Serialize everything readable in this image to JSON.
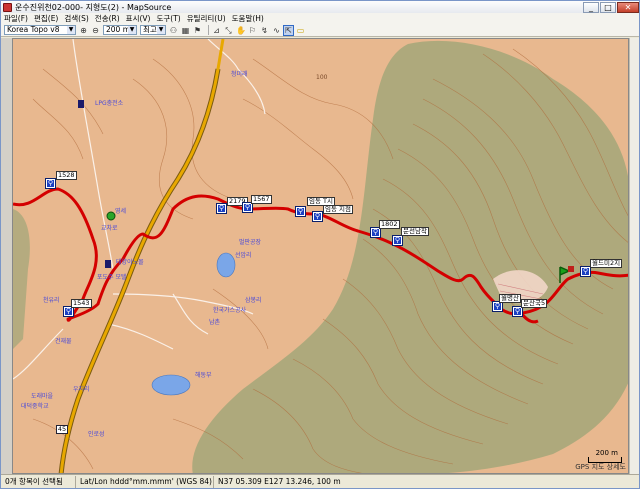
{
  "window": {
    "title": "운수진위천02-000- 지형도(2) - MapSource",
    "minimize": "_",
    "maximize": "□",
    "close": "✕"
  },
  "menu": [
    "파일(F)",
    "편집(E)",
    "검색(S)",
    "전송(R)",
    "표시(V)",
    "도구(T)",
    "유틸리티(U)",
    "도움말(H)"
  ],
  "toolbar": {
    "map_product": "Korea Topo v8",
    "zoom_value": "200 m",
    "detail": "최고"
  },
  "map": {
    "road_number": "45",
    "contour_label": "100",
    "waypoints": [
      {
        "label": "1528"
      },
      {
        "label": "2179"
      },
      {
        "label": "1567"
      },
      {
        "label": "임동 T시"
      },
      {
        "label": "임동 지점"
      },
      {
        "label": "1802"
      },
      {
        "label": "문선남작"
      },
      {
        "label": "1543"
      },
      {
        "label": "월명산"
      },
      {
        "label": "문산국5"
      },
      {
        "label": "월드미2지"
      }
    ],
    "pois": [
      "청미래",
      "LPG충전소",
      "영세",
      "교차로",
      "태양이노몰",
      "벌판공장",
      "선암리",
      "포도주 모텔",
      "천유리",
      "삼봉리",
      "남촌",
      "한국가스공사",
      "건재물",
      "해동부",
      "도래마을",
      "대덕중학교",
      "우지리",
      "인로성"
    ],
    "scale_label": "200 m",
    "attribution": "GPS 지도 상세도"
  },
  "status": {
    "count": "0개 항목이 선택됨",
    "format": "Lat/Lon hddd°mm.mmm' (WGS 84)",
    "coords": "N37 05.309 E127 13.246, 100 m"
  },
  "colors": {
    "terrain": "#e8b88f",
    "forest": "#a7a77a",
    "track": "#d40000",
    "contour": "#b06a3a",
    "water": "#7aa6e8",
    "road": "#e8a800"
  }
}
